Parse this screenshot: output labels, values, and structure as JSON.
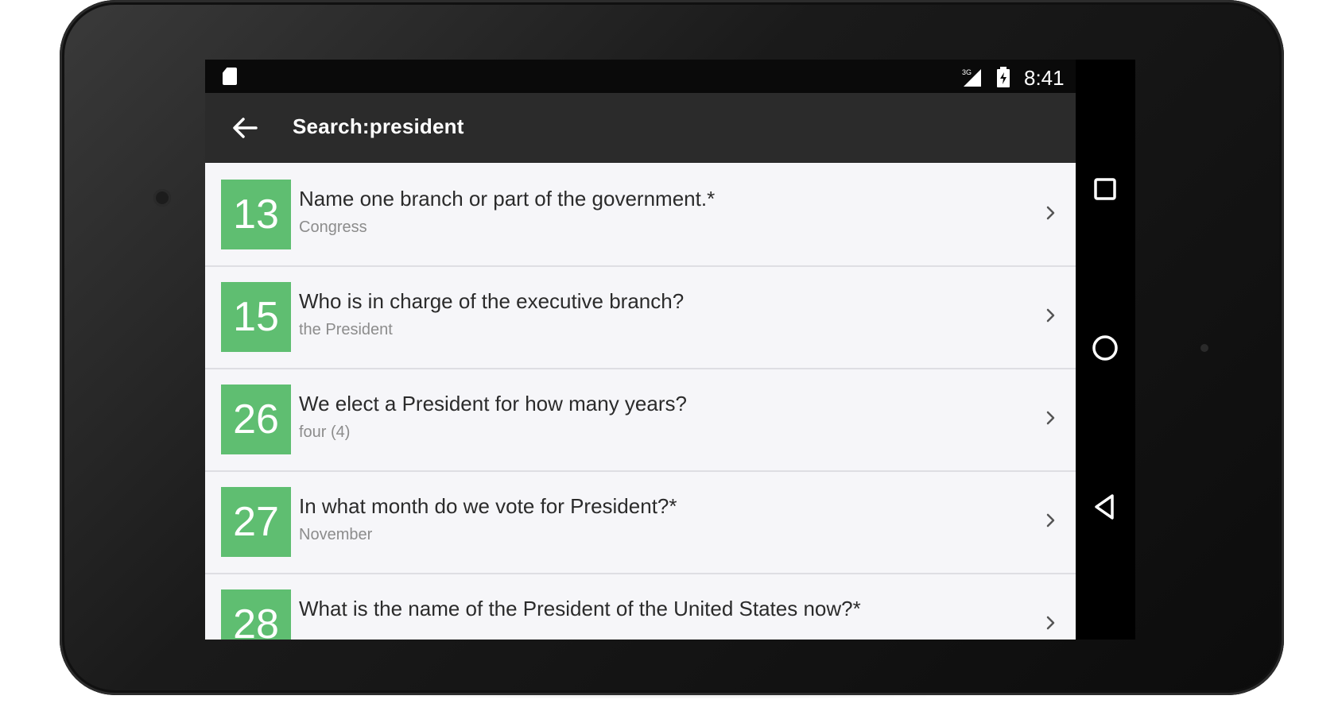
{
  "status_bar": {
    "time": "8:41",
    "icons": [
      "sd-card-icon",
      "signal-icon",
      "battery-icon"
    ]
  },
  "app_bar": {
    "title": "Search:president",
    "back_icon": "arrow-left-icon"
  },
  "results": [
    {
      "number": "13",
      "question": "Name one branch or part of the government.*",
      "answer": "Congress"
    },
    {
      "number": "15",
      "question": "Who is in charge of the executive branch?",
      "answer": "the President"
    },
    {
      "number": "26",
      "question": "We elect a President for how many years?",
      "answer": "four (4)"
    },
    {
      "number": "27",
      "question": "In what month do we vote for President?*",
      "answer": "November"
    },
    {
      "number": "28",
      "question": "What is the name of the President of the United States now?*",
      "answer": ""
    }
  ],
  "nav_bar": {
    "buttons": [
      "recents-icon",
      "home-icon",
      "back-triangle-icon"
    ]
  },
  "colors": {
    "number_box": "#5fbe71",
    "app_bar": "#2b2b2b",
    "list_bg": "#f6f6f9"
  }
}
